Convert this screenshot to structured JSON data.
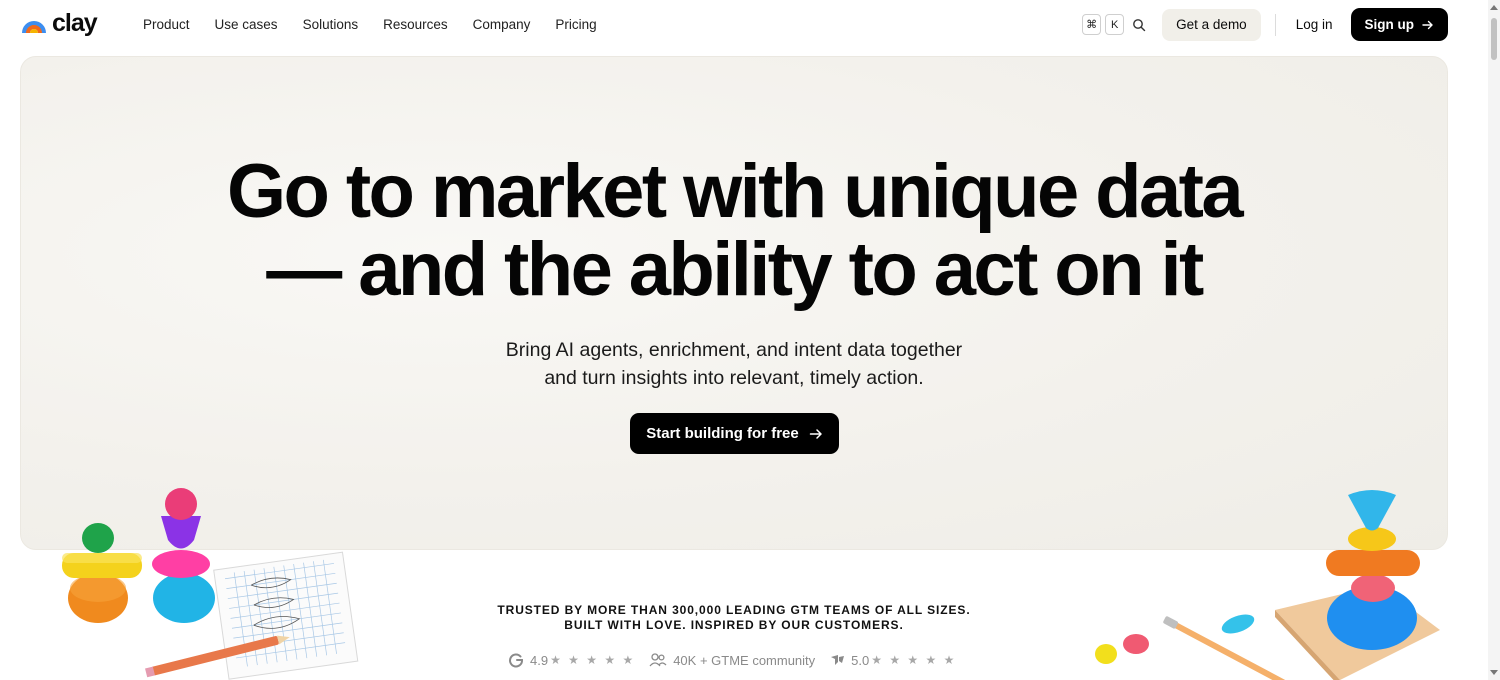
{
  "brand": {
    "name": "clay"
  },
  "nav": {
    "items": [
      {
        "label": "Product"
      },
      {
        "label": "Use cases"
      },
      {
        "label": "Solutions"
      },
      {
        "label": "Resources"
      },
      {
        "label": "Company"
      },
      {
        "label": "Pricing"
      }
    ],
    "shortcut_keys": [
      "⌘",
      "K"
    ],
    "search_icon": "search-icon",
    "demo_label": "Get a demo",
    "login_label": "Log in",
    "signup_label": "Sign up"
  },
  "hero": {
    "headline_line1": "Go to market with unique data",
    "headline_line2": "— and the ability to act on it",
    "sub_line1": "Bring AI agents, enrichment, and intent data together",
    "sub_line2": "and turn insights into relevant, timely action.",
    "cta_label": "Start building for free"
  },
  "trust": {
    "line1": "TRUSTED BY MORE THAN 300,000 LEADING GTM TEAMS OF ALL SIZES.",
    "line2": "BUILT WITH LOVE. INSPIRED BY OUR CUSTOMERS."
  },
  "ratings": {
    "g2": {
      "icon": "g2-icon",
      "score": "4.9",
      "stars": "★ ★ ★ ★ ★"
    },
    "community": {
      "icon": "community-icon",
      "text": "40K + GTME community"
    },
    "capterra": {
      "icon": "capterra-icon",
      "score": "5.0",
      "stars": "★ ★ ★ ★ ★"
    }
  },
  "colors": {
    "primary_button": "#000000",
    "demo_button_bg": "#f1efe9",
    "hero_bg": "#f3f1ec",
    "logo_yellow": "#f5b400",
    "logo_orange": "#f26a1b",
    "logo_blue": "#3d8ef0"
  }
}
